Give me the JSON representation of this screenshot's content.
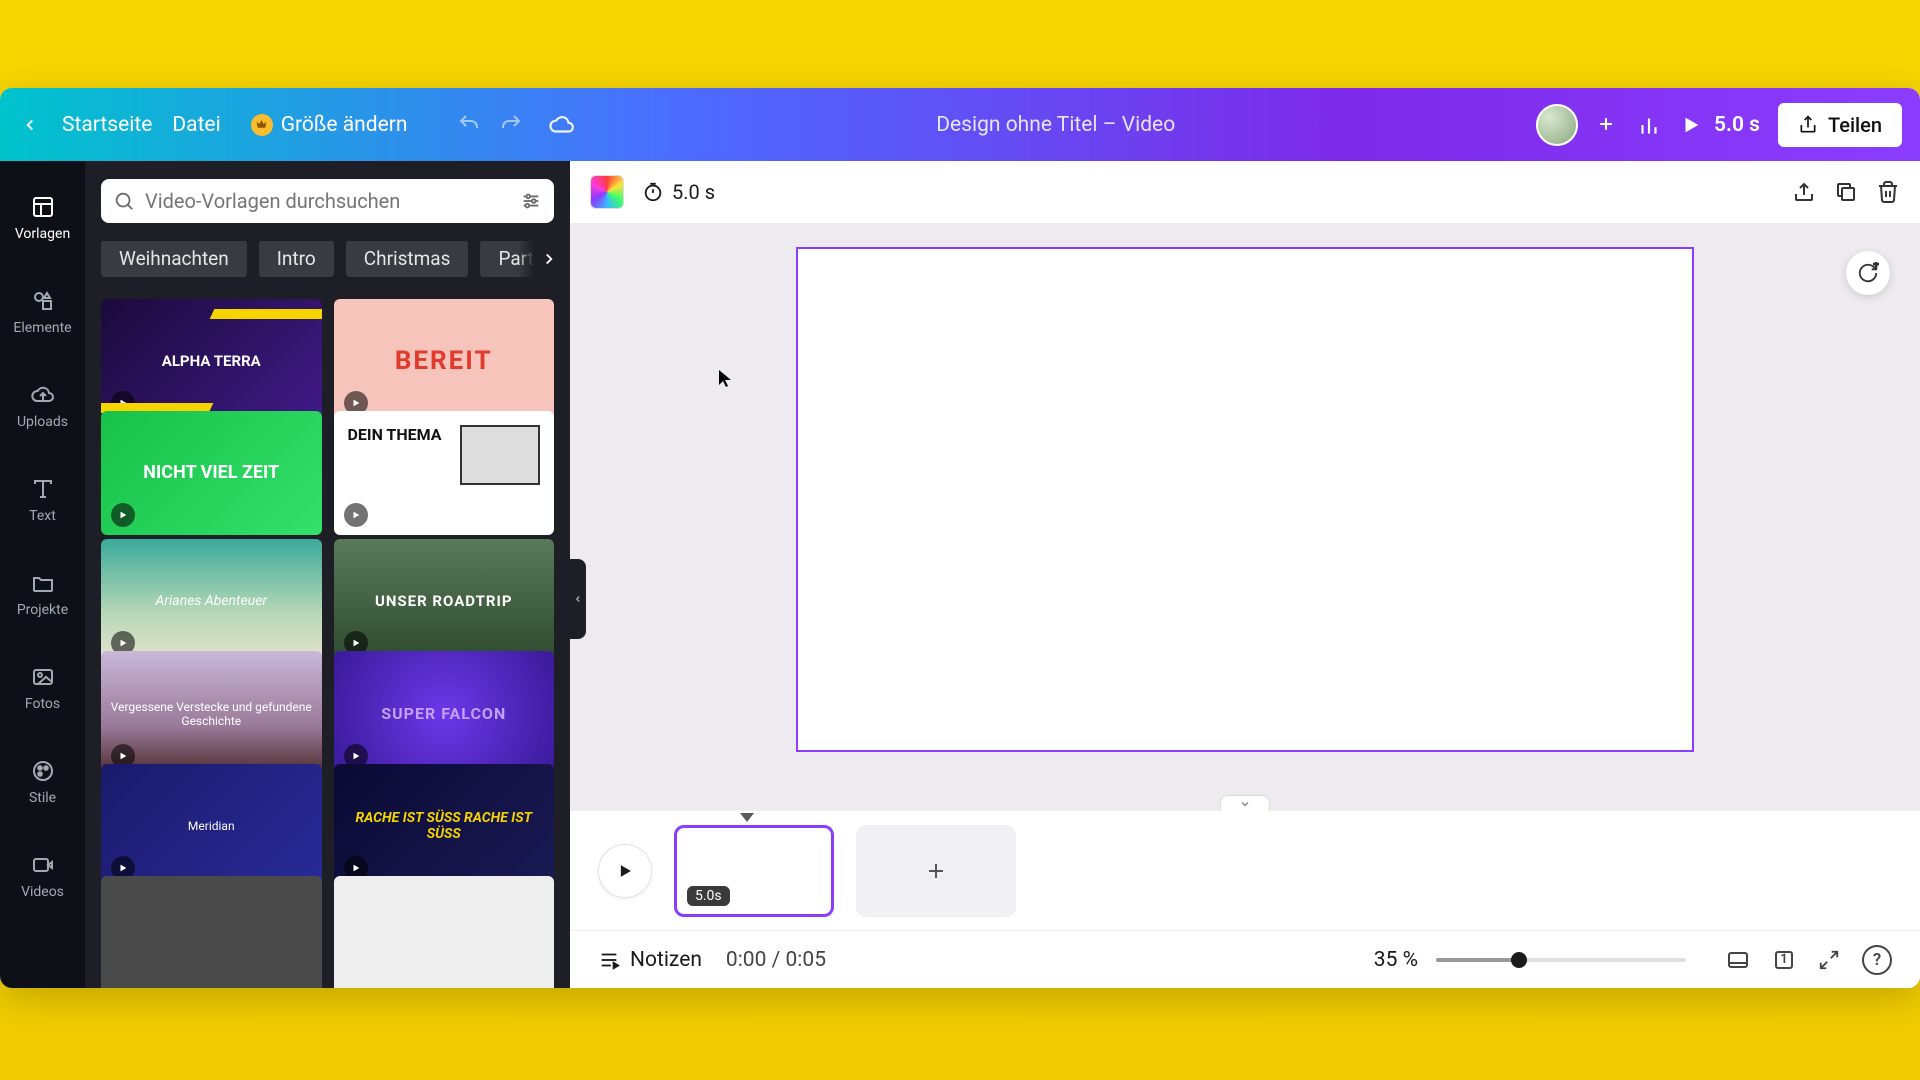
{
  "topbar": {
    "home": "Startseite",
    "file": "Datei",
    "resize": "Größe ändern",
    "title": "Design ohne Titel – Video",
    "duration": "5.0 s",
    "share": "Teilen"
  },
  "rail": {
    "templates": "Vorlagen",
    "elements": "Elemente",
    "uploads": "Uploads",
    "text": "Text",
    "projects": "Projekte",
    "photos": "Fotos",
    "styles": "Stile",
    "videos": "Videos"
  },
  "panel": {
    "search_placeholder": "Video-Vorlagen durchsuchen",
    "chips": [
      "Weihnachten",
      "Intro",
      "Christmas",
      "Party"
    ],
    "thumbs": [
      {
        "label": "ALPHA TERRA"
      },
      {
        "label": "BEREIT"
      },
      {
        "label": "NICHT VIEL ZEIT"
      },
      {
        "label": "DEIN THEMA"
      },
      {
        "label": "Arianes Abenteuer"
      },
      {
        "label": "UNSER ROADTRIP"
      },
      {
        "label": "Vergessene Verstecke und gefundene Geschichte"
      },
      {
        "label": "SUPER FALCON"
      },
      {
        "label": "Meridian"
      },
      {
        "label": "RACHE IST SÜSS RACHE IST SÜSS"
      },
      {
        "label": ""
      },
      {
        "label": ""
      }
    ]
  },
  "canvas_toolbar": {
    "duration": "5.0 s"
  },
  "timeline": {
    "clip_duration": "5.0s"
  },
  "bottombar": {
    "notes": "Notizen",
    "timecode": "0:00 / 0:05",
    "zoom_pct": "35 %",
    "zoom_value": 35,
    "page_badge": "1"
  },
  "colors": {
    "accent": "#8b3dff"
  }
}
